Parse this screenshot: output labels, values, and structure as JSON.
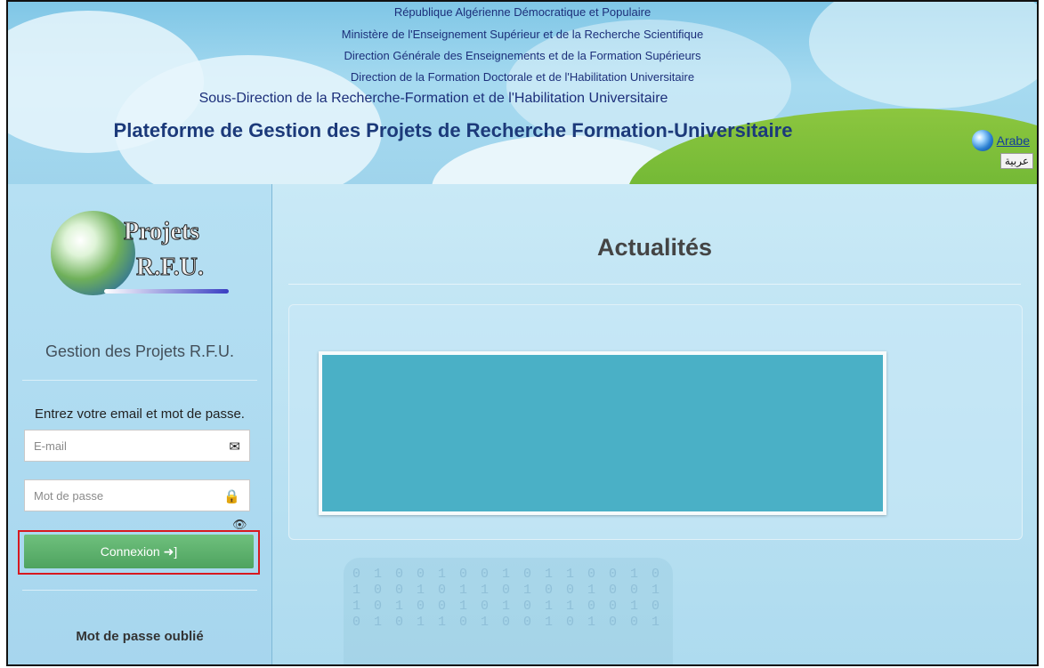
{
  "header": {
    "line1": "République Algérienne Démocratique et Populaire",
    "line2": "Ministère de l'Enseignement Supérieur et de la Recherche Scientifique",
    "line3": "Direction Générale des Enseignements et de la Formation Supérieurs",
    "line4": "Direction de la Formation Doctorale et de l'Habilitation Universitaire",
    "line5": "Sous-Direction de la Recherche-Formation et de l'Habilitation Universitaire",
    "platform_title": "Plateforme de Gestion des Projets de Recherche Formation-Universitaire",
    "arabe_link": "Arabe",
    "arabic_button": "عربية"
  },
  "sidebar": {
    "logo_text_1": "Projets",
    "logo_text_2": "R.F.U.",
    "title": "Gestion des Projets R.F.U.",
    "instructions": "Entrez votre email et mot de passe.",
    "email_placeholder": "E-mail",
    "password_placeholder": "Mot de passe",
    "login_button": "Connexion",
    "forgot_password": "Mot de passe oublié"
  },
  "main": {
    "news_title": "Actualités",
    "binary_text": "0 1 0 0 1 0 0 1 0 1 1 0 0 1 0 1 0 0 1 0 1 1 0 1 0 0 1 0 0 1 1 0 1 0 0 1 0 1 0 1 1 0 0 1 0 0 1 0 1 1 0 1 0 0 1 0 1 0 0 1"
  },
  "icons": {
    "email": "envelope-icon",
    "password": "lock-icon",
    "show_password": "eye-icon",
    "login": "sign-in-icon",
    "language": "globe-icon"
  },
  "colors": {
    "login_button": "#56a867",
    "highlight_outline": "#d71920",
    "news_card": "#4ab0c6",
    "header_title": "#1c3a7a"
  }
}
